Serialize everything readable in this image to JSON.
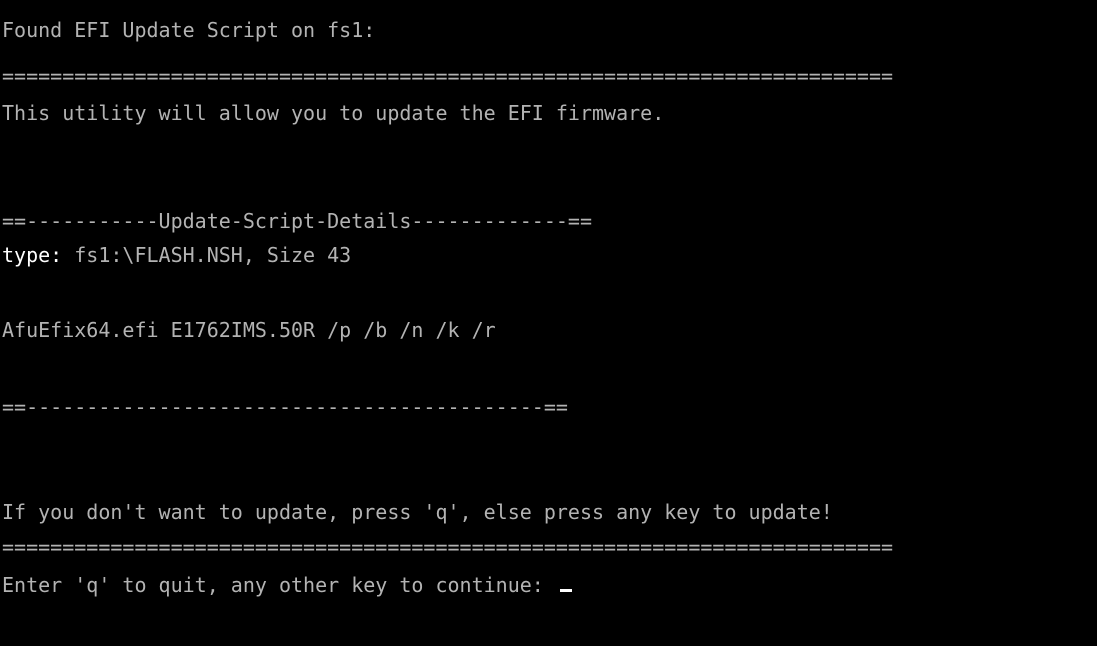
{
  "terminal": {
    "found_line": "Found EFI Update Script on fs1:",
    "separator_full": "==========================================================================",
    "intro_line": "This utility will allow you to update the EFI firmware.",
    "details_header": "==-----------Update-Script-Details-------------==",
    "type_label": "type:",
    "type_value": " fs1:\\FLASH.NSH, Size 43",
    "script_command": "AfuEfix64.efi E1762IMS.50R /p /b /n /k /r",
    "details_footer": "==-------------------------------------------==",
    "prompt_line": "If you don't want to update, press 'q', else press any key to update!",
    "separator_full_2": "==========================================================================",
    "input_prompt": "Enter 'q' to quit, any other key to continue: "
  },
  "colors": {
    "background": "#000000",
    "text": "#b3b3b3",
    "highlight": "#ffffff"
  }
}
